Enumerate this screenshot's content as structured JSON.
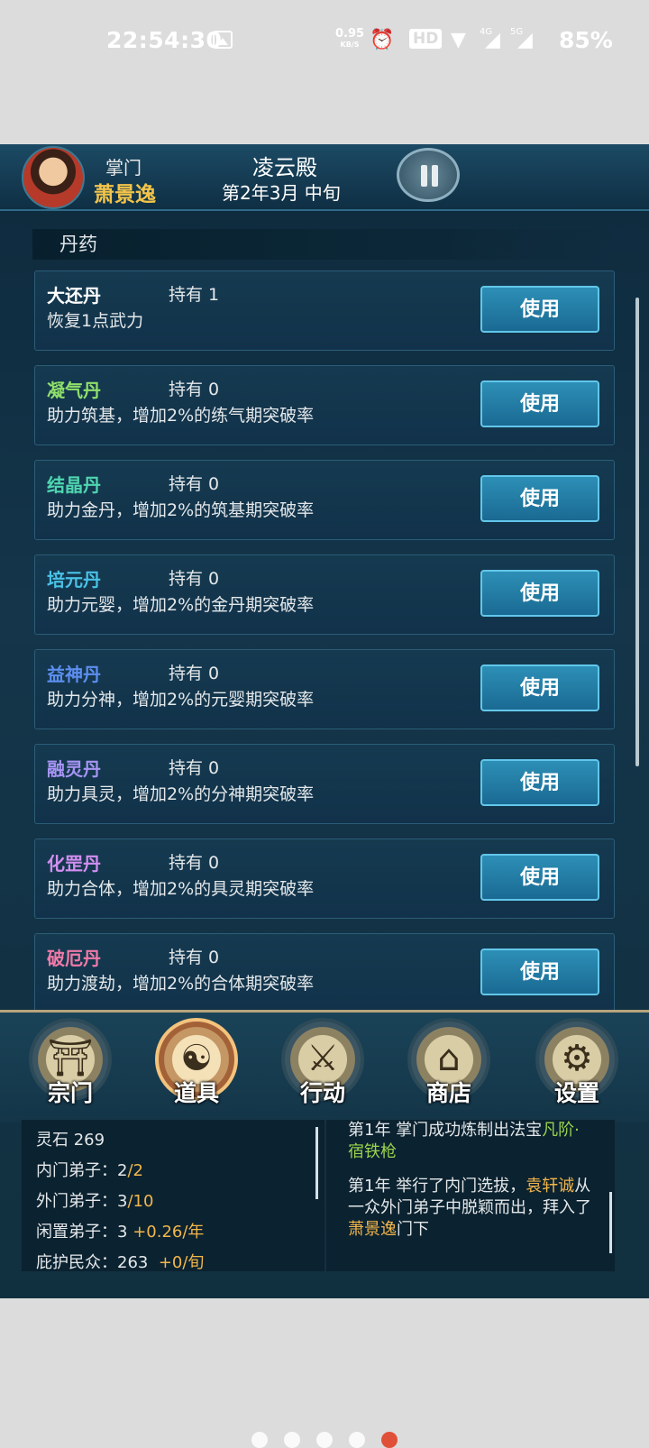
{
  "status_bar": {
    "time": "22:54:30",
    "net_speed": "0.95",
    "net_unit": "KB/S",
    "hd": "HD",
    "net_4g": "4G",
    "net_5g": "5G",
    "battery": "85%",
    "icons": [
      "gallery-icon",
      "alarm-icon",
      "wifi-icon",
      "signal-icon"
    ]
  },
  "header": {
    "role": "掌门",
    "leader_name": "萧景逸",
    "hall_name": "凌云殿",
    "game_date": "第2年3月 中旬"
  },
  "section_title": "丹药",
  "pills": [
    {
      "name": "大还丹",
      "color": "#ffffff",
      "held": "持有 1",
      "desc": "恢复1点武力",
      "button": "使用"
    },
    {
      "name": "凝气丹",
      "color": "#8fe06a",
      "held": "持有 0",
      "desc": "助力筑基，增加2%的练气期突破率",
      "button": "使用"
    },
    {
      "name": "结晶丹",
      "color": "#4fd6b0",
      "held": "持有 0",
      "desc": "助力金丹，增加2%的筑基期突破率",
      "button": "使用"
    },
    {
      "name": "培元丹",
      "color": "#49c2e6",
      "held": "持有 0",
      "desc": "助力元婴，增加2%的金丹期突破率",
      "button": "使用"
    },
    {
      "name": "益神丹",
      "color": "#5d8ef0",
      "held": "持有 0",
      "desc": "助力分神，增加2%的元婴期突破率",
      "button": "使用"
    },
    {
      "name": "融灵丹",
      "color": "#a794f4",
      "held": "持有 0",
      "desc": "助力具灵，增加2%的分神期突破率",
      "button": "使用"
    },
    {
      "name": "化罡丹",
      "color": "#d38ef0",
      "held": "持有 0",
      "desc": "助力合体，增加2%的具灵期突破率",
      "button": "使用"
    },
    {
      "name": "破厄丹",
      "color": "#f07aa8",
      "held": "持有 0",
      "desc": "助力渡劫，增加2%的合体期突破率",
      "button": "使用"
    }
  ],
  "nav": [
    {
      "label": "宗门",
      "icon": "sect-gate-icon",
      "active": false
    },
    {
      "label": "道具",
      "icon": "item-bag-icon",
      "active": true
    },
    {
      "label": "行动",
      "icon": "action-icon",
      "active": false
    },
    {
      "label": "商店",
      "icon": "shop-icon",
      "active": false
    },
    {
      "label": "设置",
      "icon": "gear-icon",
      "active": false
    }
  ],
  "stats": {
    "spirit_stone": "灵石 269",
    "inner_label": "内门弟子：2",
    "inner_max": "/2",
    "outer_label": "外门弟子：3",
    "outer_max": "/10",
    "idle_label": "闲置弟子：3",
    "idle_rate": "+0.26/年",
    "people_label": "庇护民众：263",
    "people_rate": "+0/旬"
  },
  "log": {
    "e1_prefix": "第1年  掌门成功炼制出法宝",
    "e1_item": "凡阶·宿铁枪",
    "e2_prefix": "第1年  举行了内门选拔，",
    "e2_name": "袁轩诚",
    "e2_mid": "从一众外门弟子中脱颖而出，拜入了",
    "e2_master": "萧景逸",
    "e2_suffix": "门下"
  },
  "pager": {
    "count": 5,
    "active_index": 4
  }
}
